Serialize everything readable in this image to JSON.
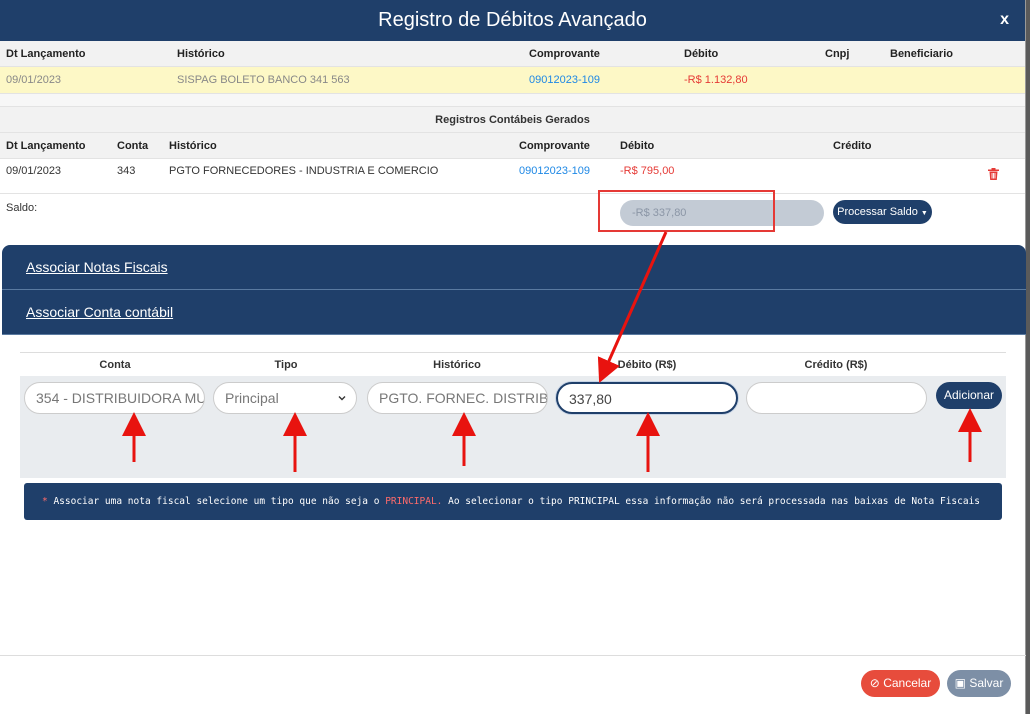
{
  "modal": {
    "title": "Registro de Débitos Avançado",
    "close_label": "x"
  },
  "top_table": {
    "headers": {
      "date": "Dt Lançamento",
      "historico": "Histórico",
      "comprovante": "Comprovante",
      "debito": "Débito",
      "cnpj": "Cnpj",
      "beneficiario": "Beneficiario"
    },
    "row": {
      "date": "09/01/2023",
      "historico": "SISPAG BOLETO BANCO 341 563",
      "comprovante": "09012023-109",
      "debito": "-R$ 1.132,80"
    }
  },
  "generated": {
    "title": "Registros Contábeis Gerados",
    "headers": {
      "date": "Dt Lançamento",
      "conta": "Conta",
      "historico": "Histórico",
      "comprovante": "Comprovante",
      "debito": "Débito",
      "credito": "Crédito"
    },
    "row": {
      "date": "09/01/2023",
      "conta": "343",
      "historico": "PGTO FORNECEDORES - INDUSTRIA E COMERCIO",
      "comprovante": "09012023-109",
      "debito": "-R$ 795,00"
    }
  },
  "saldo": {
    "label": "Saldo:",
    "value": "-R$ 337,80",
    "process_button": "Processar Saldo"
  },
  "accordion": {
    "item1": "Associar Notas Fiscais",
    "item2": "Associar Conta contábil"
  },
  "form": {
    "headers": {
      "conta": "Conta",
      "tipo": "Tipo",
      "historico": "Histórico",
      "debito": "Débito (R$)",
      "credito": "Crédito (R$)"
    },
    "conta_value": "354 - DISTRIBUIDORA MU",
    "tipo_value": "Principal",
    "historico_value": "PGTO. FORNEC. DISTRIB",
    "debito_value": "337,80",
    "credito_value": "",
    "add_button": "Adicionar"
  },
  "notice": {
    "star": "*",
    "part1": " Associar uma nota fiscal selecione um tipo que não seja o ",
    "highlight": "PRINCIPAL.",
    "part2": " Ao selecionar o tipo PRINCIPAL essa informação não será processada nas baixas de Nota Fiscais"
  },
  "footer": {
    "cancel": "Cancelar",
    "save": "Salvar"
  },
  "colors": {
    "primary": "#1f3f6a",
    "danger": "#e53935",
    "link": "#1e88e5",
    "highlight_row": "#fdf8c6",
    "annotation": "#e8130f"
  }
}
